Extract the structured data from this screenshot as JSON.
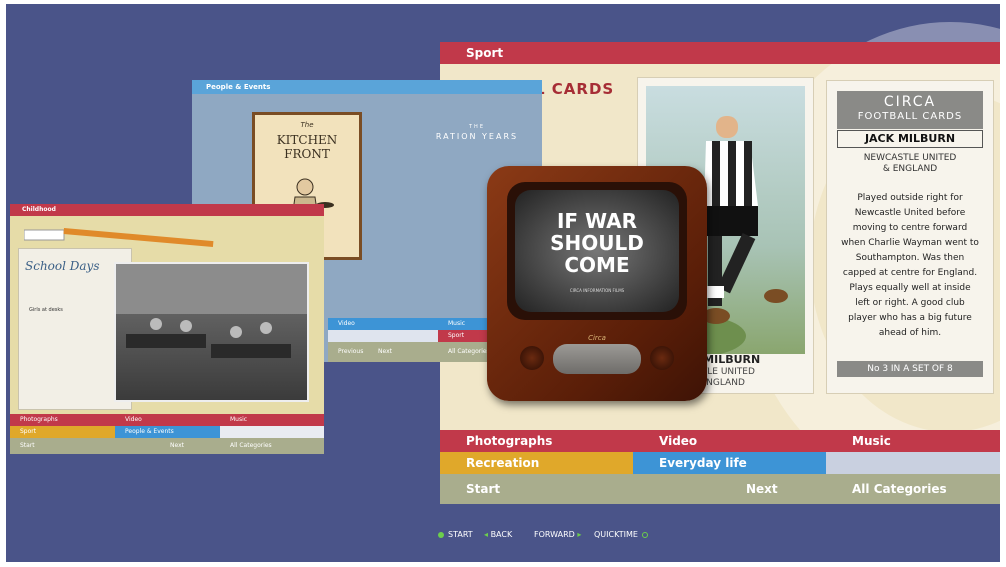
{
  "sport_screen": {
    "header": "Sport",
    "cards_title": "L CARDS",
    "player_name": "K MILBURN",
    "player_club_line1": "STLE UNITED",
    "player_club_line2": "NGLAND",
    "info_card": {
      "brand": "CIRCA",
      "subtitle": "FOOTBALL CARDS",
      "name": "JACK MILBURN",
      "club_line1": "NEWCASTLE UNITED",
      "club_line2": "& ENGLAND",
      "text": "Played outside right for Newcastle United before moving to centre forward when Charlie Wayman went to Southampton. Was then capped at centre for England. Plays equally well at inside left or right. A good club player who has a big future ahead of him.",
      "footer": "No 3 IN A SET OF 8"
    },
    "row1": [
      "Photographs",
      "Video",
      "Music"
    ],
    "row2": [
      "Recreation",
      "Everyday life",
      ""
    ],
    "row3": [
      "Start",
      "Next",
      "All Categories"
    ],
    "colors": {
      "red": "#c1394a",
      "yellow": "#e0a82a",
      "blue": "#3d94d6",
      "grey": "#a9ad8d",
      "light": "#c9d0e0"
    }
  },
  "people_screen": {
    "header": "People & Events",
    "book_title": "KITCHEN FRONT",
    "book_kicker": "The",
    "ration_the": "THE",
    "ration_title": "RATION YEARS",
    "row1": [
      "Video"
    ],
    "row2": [
      "Sport"
    ],
    "row3": [
      "Previous",
      "Next",
      "All Categories"
    ],
    "music": "Music"
  },
  "school_screen": {
    "header": "Childhood",
    "title": "School Days",
    "sub": "Girls at desks",
    "row1": [
      "Photographs",
      "Video",
      "Music"
    ],
    "row2": [
      "Sport",
      "People & Events",
      ""
    ],
    "row3": [
      "Start",
      "Next",
      "All Categories"
    ]
  },
  "tv": {
    "line1": "IF WAR",
    "line2": "SHOULD",
    "line3": "COME",
    "small": "CIRCA INFORMATION FILMS",
    "brand": "Circa"
  },
  "bottom_nav": {
    "start": "START",
    "back": "BACK",
    "forward": "FORWARD",
    "quicktime": "QUICKTIME"
  }
}
